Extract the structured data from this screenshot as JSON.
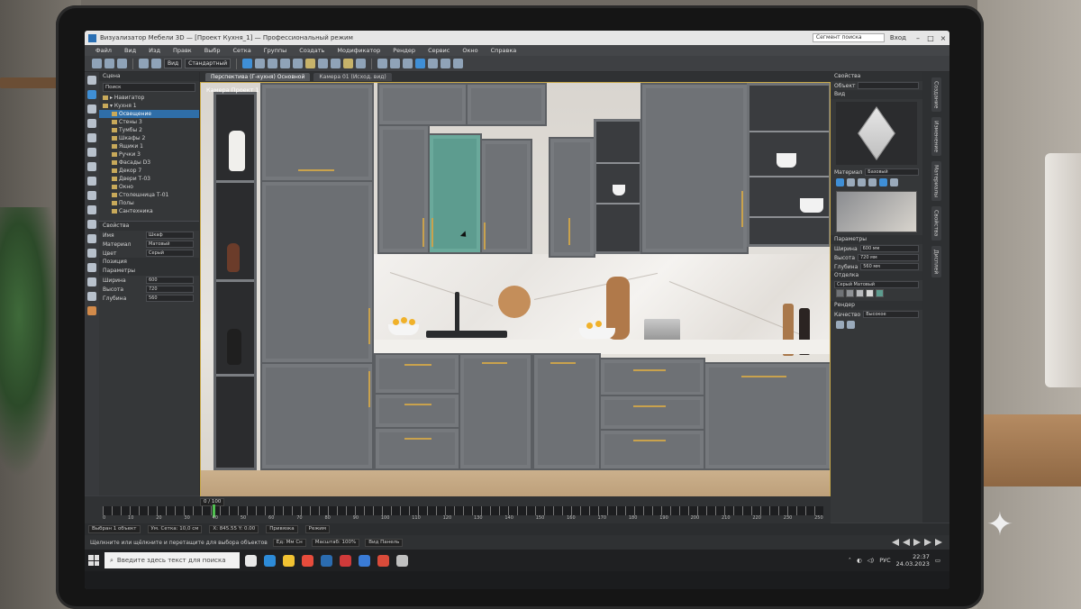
{
  "window": {
    "title": "Визуализатор Мебели 3D — [Проект Кухня_1] — Профессиональный режим",
    "search_placeholder": "Сегмент поиска",
    "user_label": "Вход"
  },
  "menu": [
    "Файл",
    "Вид",
    "Изд",
    "Правк",
    "Выбр",
    "Сетка",
    "Группы",
    "Создать",
    "Модификатор",
    "Рендер",
    "Сервис",
    "Окно",
    "Справка"
  ],
  "toolbar": {
    "view_select": "Вид",
    "mode_select": "Стандартный"
  },
  "scene_panel": {
    "header": "Сцена",
    "search": "Поиск",
    "tree": [
      {
        "label": "▸ Навигатор"
      },
      {
        "label": "▾ Кухня 1"
      },
      {
        "label": "Освещение",
        "selected": true
      },
      {
        "label": "Стены 3"
      },
      {
        "label": "Тумбы 2"
      },
      {
        "label": "Шкафы 2"
      },
      {
        "label": "Ящики 1"
      },
      {
        "label": "Ручки 3"
      },
      {
        "label": "Фасады D3"
      },
      {
        "label": "Декор 7"
      },
      {
        "label": "Двери Т-03"
      },
      {
        "label": "Окно"
      },
      {
        "label": "Столешница Т-01"
      },
      {
        "label": "Полы"
      },
      {
        "label": "Сантехника"
      }
    ],
    "props_header": "Свойства",
    "props": [
      {
        "label": "Имя",
        "value": "Шкаф"
      },
      {
        "label": "Материал",
        "value": "Матовый"
      },
      {
        "label": "Цвет",
        "value": "Серый"
      }
    ],
    "section2": "Позиция",
    "section3": "Параметры",
    "props2": [
      {
        "label": "Ширина",
        "value": "600"
      },
      {
        "label": "Высота",
        "value": "720"
      },
      {
        "label": "Глубина",
        "value": "560"
      }
    ]
  },
  "viewport": {
    "tabs": [
      "Перспектива (Г-кухня) Основной",
      "Камера 01 (Исход. вид)"
    ],
    "label": "Камера Проект 1"
  },
  "right_panel": {
    "header": "Свойства",
    "name_label": "Объект",
    "view_header": "Вид",
    "materials_header": "Материал",
    "materials_value": "Базовый",
    "params_header": "Параметры",
    "params": [
      {
        "label": "Ширина",
        "value": "600 мм"
      },
      {
        "label": "Высота",
        "value": "720 мм"
      },
      {
        "label": "Глубина",
        "value": "560 мм"
      }
    ],
    "finish_header": "Отделка",
    "finish_value": "Серый Матовый",
    "render_header": "Рендер",
    "render_label": "Качество",
    "render_value": "Высокое",
    "swatch_colors": [
      "#6f7276",
      "#8e9195",
      "#b8babd",
      "#d8d8d8",
      "#5d9c8f"
    ]
  },
  "vertical_tabs": [
    "Создание",
    "Изменение",
    "Материалы",
    "Свойства",
    "Дисплей"
  ],
  "timeline": {
    "frame_field": "0 / 100",
    "ticks": [
      "0",
      "10",
      "20",
      "30",
      "40",
      "50",
      "60",
      "70",
      "80",
      "90",
      "100",
      "110",
      "120",
      "130",
      "140",
      "150",
      "160",
      "170",
      "180",
      "190",
      "200",
      "210",
      "220",
      "230",
      "250"
    ]
  },
  "statusbar": {
    "field1": "Выбран 1 объект",
    "field2": "Ум.  Сетка: 10,0 см",
    "coords": "X: 845.55  Y: 0.00",
    "snap": "Привязка",
    "mode": "Режим"
  },
  "bottombar": {
    "info": "Щелкните или щёлкните и перетащите для выбора объектов",
    "units": "Ед: Мм Сн",
    "scale": "Масштаб: 100%",
    "view_label": "Вид Панель"
  },
  "taskbar": {
    "search_placeholder": "Введите здесь текст для поиска",
    "lang": "РУС",
    "time": "22:37",
    "date": "24.03.2023",
    "apps": [
      "#e8e8e8",
      "#2d8bd8",
      "#f1c232",
      "#e74c3c",
      "#2b6cb0",
      "#cf3a3a",
      "#3a7bd5",
      "#d94b3a",
      "#c0c0c0"
    ]
  }
}
